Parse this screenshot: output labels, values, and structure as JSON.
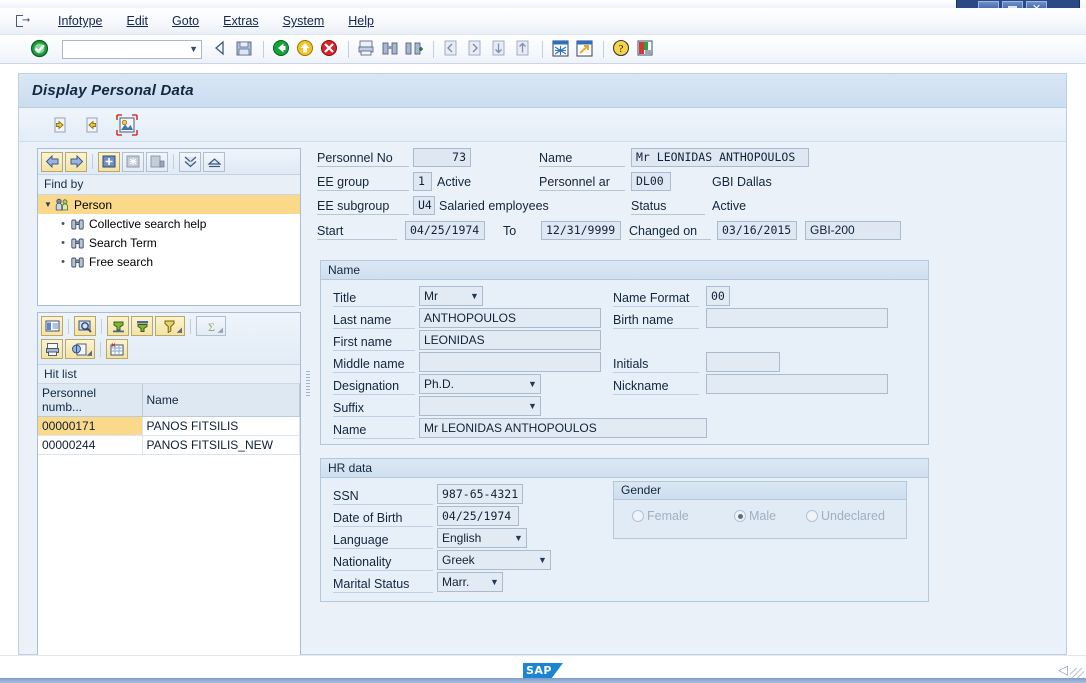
{
  "window": {
    "buttons": [
      {
        "name": "minimize",
        "label": "_"
      },
      {
        "name": "maximize",
        "label": "□"
      },
      {
        "name": "close",
        "label": "✕"
      }
    ]
  },
  "menubar": {
    "icon": "exit-door-icon",
    "items": [
      "Infotype",
      "Edit",
      "Goto",
      "Extras",
      "System",
      "Help"
    ]
  },
  "toolbar": {
    "command_field_value": "",
    "command_field_placeholder": "",
    "icons": [
      "enter-check-icon",
      "back-arrow-icon",
      "save-icon",
      "back-green-icon",
      "exit-yellow-icon",
      "cancel-red-icon",
      "print-icon",
      "find-icon",
      "find-next-icon",
      "first-page-icon",
      "previous-page-icon",
      "next-page-icon",
      "last-page-icon",
      "new-window-icon",
      "create-session-icon",
      "help-icon",
      "layout-menu-icon"
    ]
  },
  "screen": {
    "title": "Display Personal Data",
    "appbar_icons": [
      "previous-record-icon",
      "next-record-icon",
      "photo-icon"
    ]
  },
  "sidebar": {
    "nav_toolbar_icons": [
      "back-icon",
      "forward-icon",
      "add-node-icon",
      "node-icon",
      "delete-node-icon",
      "expand-all-icon",
      "collapse-all-icon"
    ],
    "find_by_header": "Find by",
    "tree": {
      "root": {
        "label": "Person",
        "icon": "person-icon",
        "selected": true
      },
      "children": [
        {
          "label": "Collective search help",
          "icon": "binoculars-icon"
        },
        {
          "label": "Search Term",
          "icon": "binoculars-icon"
        },
        {
          "label": "Free search",
          "icon": "binoculars-icon"
        }
      ]
    },
    "hit_toolbar_icons_row1": [
      "detail-list-icon",
      "search-zoom-icon",
      "sort-ascending-icon",
      "sort-descending-icon",
      "filter-icon",
      "sum-icon"
    ],
    "hit_toolbar_icons_row2": [
      "print-preview-icon",
      "copy-icon",
      "spreadsheet-icon"
    ],
    "hit_list_header": "Hit list",
    "hit_list": {
      "columns": [
        "Personnel numb...",
        "Name"
      ],
      "rows": [
        {
          "personnel_number": "00000171",
          "name": "PANOS FITSILIS",
          "selected": true
        },
        {
          "personnel_number": "00000244",
          "name": "PANOS FITSILIS_NEW",
          "selected": false
        }
      ]
    }
  },
  "header": {
    "personnel_no_label": "Personnel No",
    "personnel_no_value": "73",
    "name_label": "Name",
    "name_value": "Mr LEONIDAS ANTHOPOULOS",
    "ee_group_label": "EE group",
    "ee_group_value": "1",
    "ee_group_text": "Active",
    "personnel_area_label": "Personnel ar",
    "personnel_area_value": "DL00",
    "personnel_area_text": "GBI Dallas",
    "ee_subgroup_label": "EE subgroup",
    "ee_subgroup_value": "U4",
    "ee_subgroup_text": "Salaried employees",
    "status_label": "Status",
    "status_text": "Active",
    "start_label": "Start",
    "start_value": "04/25/1974",
    "to_label": "To",
    "to_value": "12/31/9999",
    "changed_on_label": "Changed on",
    "changed_on_value": "03/16/2015",
    "client_value": "GBI-200"
  },
  "name_group": {
    "caption": "Name",
    "title_label": "Title",
    "title_value": "Mr",
    "name_format_label": "Name Format",
    "name_format_value": "00",
    "last_name_label": "Last name",
    "last_name_value": "ANTHOPOULOS",
    "birth_name_label": "Birth name",
    "birth_name_value": "",
    "first_name_label": "First name",
    "first_name_value": "LEONIDAS",
    "middle_name_label": "Middle name",
    "middle_name_value": "",
    "initials_label": "Initials",
    "initials_value": "",
    "designation_label": "Designation",
    "designation_value": "Ph.D.",
    "nickname_label": "Nickname",
    "nickname_value": "",
    "suffix_label": "Suffix",
    "suffix_value": "",
    "full_name_label": "Name",
    "full_name_value": "Mr LEONIDAS ANTHOPOULOS"
  },
  "hr_group": {
    "caption": "HR data",
    "ssn_label": "SSN",
    "ssn_value": "987-65-4321",
    "dob_label": "Date of Birth",
    "dob_value": "04/25/1974",
    "language_label": "Language",
    "language_value": "English",
    "nationality_label": "Nationality",
    "nationality_value": "Greek",
    "marital_status_label": "Marital Status",
    "marital_status_value": "Marr.",
    "gender": {
      "caption": "Gender",
      "options": [
        {
          "label": "Female",
          "selected": false
        },
        {
          "label": "Male",
          "selected": true
        },
        {
          "label": "Undeclared",
          "selected": false
        }
      ]
    }
  },
  "statusbar": {
    "logo": "SAP",
    "collapse_icon": "collapse-left-icon"
  },
  "colors": {
    "accent_blue": "#2a4a86",
    "selection_yellow": "#fbd98b",
    "panel_blue": "#e7eff8",
    "sap_logo_blue": "#1b84d3"
  }
}
